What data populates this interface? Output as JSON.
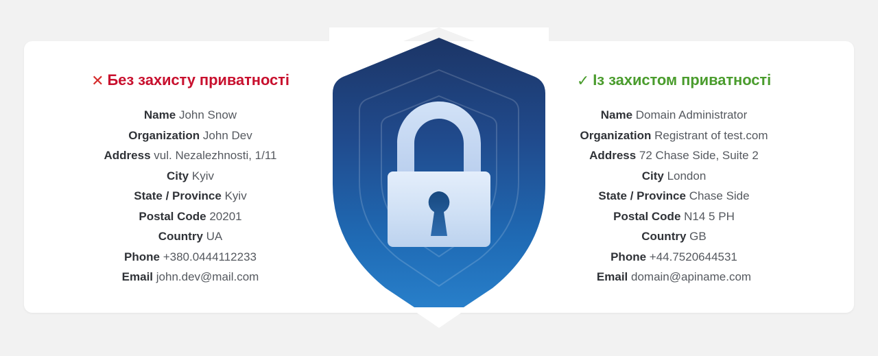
{
  "theme": {
    "page_background": "#f2f2f2",
    "card_background": "#ffffff",
    "bad_color": "#c8102e",
    "good_color": "#4a9c2d",
    "label_color": "#2f3237",
    "value_color": "#55595f",
    "shield_top": "#1e3a6d",
    "shield_bottom": "#2279c4",
    "lock_light": "#dce8f8",
    "lock_mid": "#c3d6ef",
    "keyhole": "#2a5ea0"
  },
  "left_panel": {
    "mark": "✕",
    "mark_name": "cross-icon",
    "heading": "Без захисту приватності",
    "rows": [
      {
        "label": "Name",
        "value": "John Snow"
      },
      {
        "label": "Organization",
        "value": "John Dev"
      },
      {
        "label": "Address",
        "value": "vul. Nezalezhnosti, 1/11"
      },
      {
        "label": "City",
        "value": "Kyiv"
      },
      {
        "label": "State / Province",
        "value": "Kyiv"
      },
      {
        "label": "Postal Code",
        "value": "20201"
      },
      {
        "label": "Country",
        "value": "UA"
      },
      {
        "label": "Phone",
        "value": "+380.0444112233"
      },
      {
        "label": "Email",
        "value": "john.dev@mail.com"
      }
    ]
  },
  "right_panel": {
    "mark": "✓",
    "mark_name": "check-icon",
    "heading": "Із захистом приватності",
    "rows": [
      {
        "label": "Name",
        "value": "Domain Administrator"
      },
      {
        "label": "Organization",
        "value": "Registrant of test.com"
      },
      {
        "label": "Address",
        "value": "72 Chase Side, Suite 2"
      },
      {
        "label": "City",
        "value": "London"
      },
      {
        "label": "State / Province",
        "value": "Chase Side"
      },
      {
        "label": "Postal Code",
        "value": "N14 5 PH"
      },
      {
        "label": "Country",
        "value": "GB"
      },
      {
        "label": "Phone",
        "value": "+44.7520644531"
      },
      {
        "label": "Email",
        "value": "domain@apiname.com"
      }
    ]
  },
  "center_graphic": {
    "name": "shield-lock-illustration",
    "shield_icon": "shield-icon",
    "lock_icon": "padlock-icon"
  }
}
